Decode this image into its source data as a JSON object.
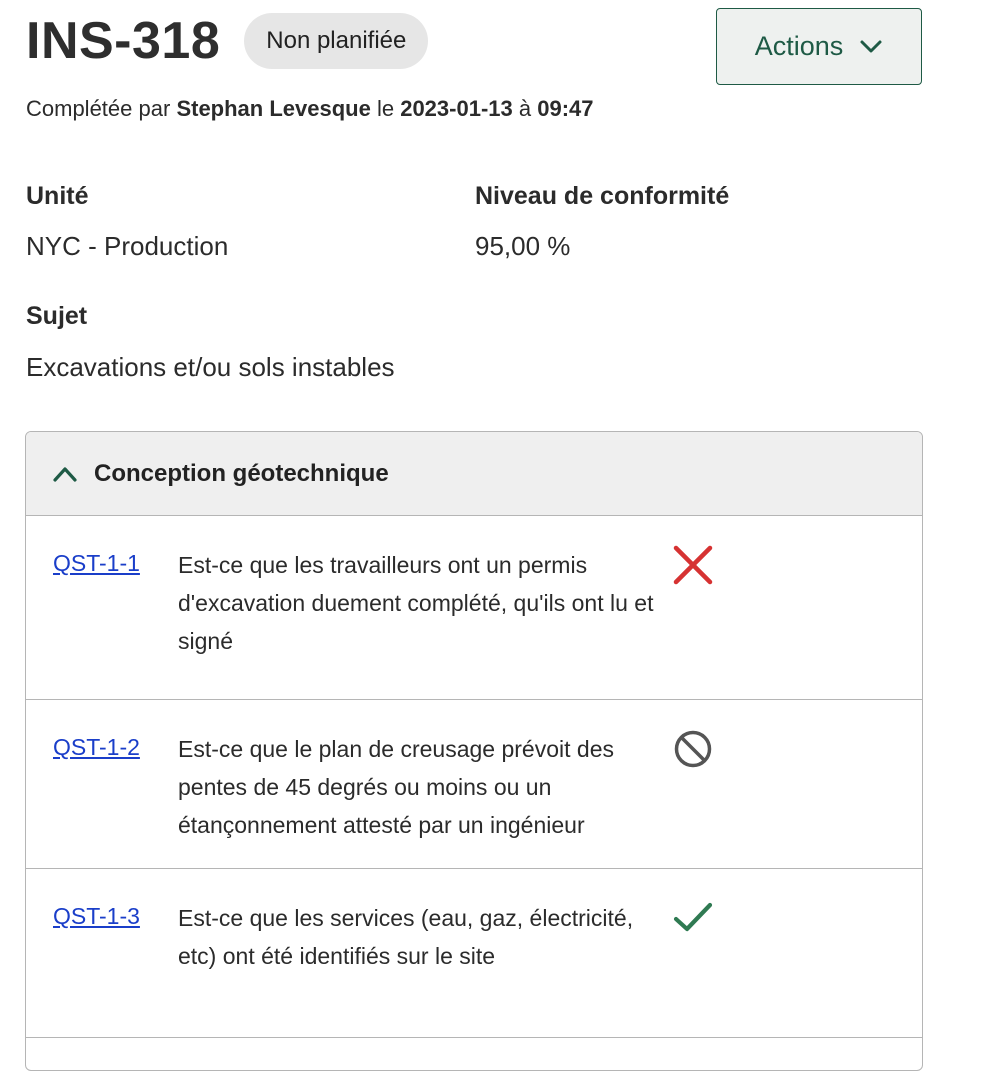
{
  "header": {
    "title": "INS-318",
    "status_badge": "Non planifiée",
    "actions_label": "Actions"
  },
  "completed": {
    "prefix": "Complétée par",
    "person": "Stephan Levesque",
    "le": "le",
    "date": "2023-01-13",
    "a": "à",
    "time": "09:47"
  },
  "fields": {
    "unit_label": "Unité",
    "unit_value": "NYC - Production",
    "conformity_label": "Niveau de conformité",
    "conformity_value": "95,00 %",
    "subject_label": "Sujet",
    "subject_value": "Excavations et/ou sols instables"
  },
  "section": {
    "title": "Conception géotechnique",
    "questions": [
      {
        "code": "QST-1-1",
        "text": "Est-ce que les travailleurs ont un permis d'excavation duement complété, qu'ils ont lu et signé",
        "status_icon": "x-icon",
        "status_color": "#d63232"
      },
      {
        "code": "QST-1-2",
        "text": "Est-ce que le plan de creusage prévoit des pentes de 45 degrés ou moins ou un étançonnement attesté par un ingénieur",
        "status_icon": "not-applicable-icon",
        "status_color": "#555555"
      },
      {
        "code": "QST-1-3",
        "text": "Est-ce que les services (eau, gaz, électricité, etc) ont été identifiés sur le site",
        "status_icon": "check-icon",
        "status_color": "#2f7a52"
      }
    ]
  },
  "colors": {
    "accent": "#1e5a45",
    "link": "#1a3ec9",
    "badge_bg": "#e6e6e6"
  }
}
